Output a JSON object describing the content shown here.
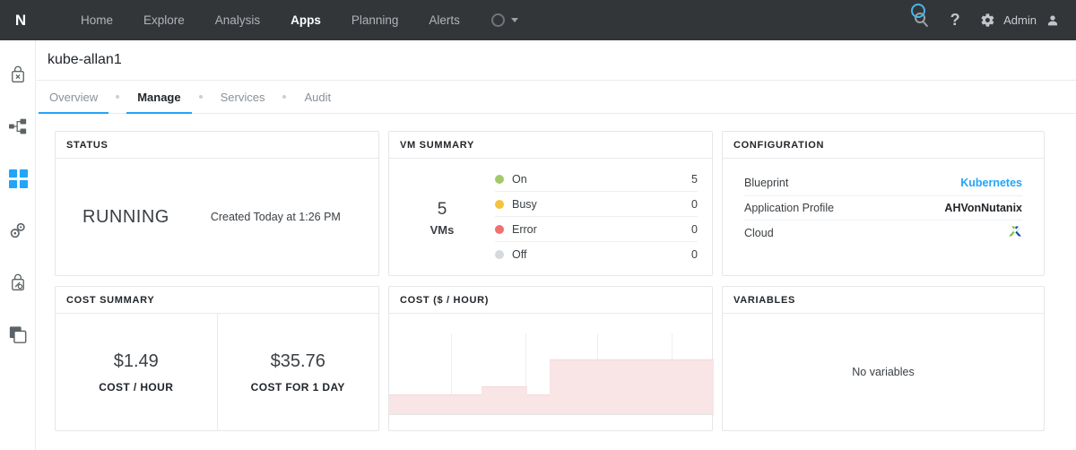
{
  "topnav": {
    "logo": "N",
    "items": [
      {
        "label": "Home",
        "active": false
      },
      {
        "label": "Explore",
        "active": false
      },
      {
        "label": "Analysis",
        "active": false
      },
      {
        "label": "Apps",
        "active": true
      },
      {
        "label": "Planning",
        "active": false
      },
      {
        "label": "Alerts",
        "active": false
      }
    ],
    "circle_menu_icon": "circle-chevron-icon",
    "search_icon": "search-icon",
    "help_icon": "question-mark-icon",
    "settings_icon": "gear-icon",
    "user_label": "Admin",
    "user_icon": "person-icon",
    "bg_color": "#333639",
    "cursor_highlight_color": "#48b5e8"
  },
  "rail": {
    "items": [
      {
        "icon": "bag-x-icon",
        "active": false
      },
      {
        "icon": "network-nodes-icon",
        "active": false
      },
      {
        "icon": "apps-grid-icon",
        "active": true
      },
      {
        "icon": "gears-icon",
        "active": false
      },
      {
        "icon": "bag-gear-icon",
        "active": false
      },
      {
        "icon": "layers-icon",
        "active": false
      }
    ],
    "active_color": "#22a5f7",
    "inactive_color": "#5c6366"
  },
  "page": {
    "title": "kube-allan1"
  },
  "tabs": [
    {
      "label": "Overview",
      "active": false,
      "underlined": true
    },
    {
      "label": "Manage",
      "active": true,
      "underlined": true
    },
    {
      "label": "Services",
      "active": false,
      "underlined": false
    },
    {
      "label": "Audit",
      "active": false,
      "underlined": false
    }
  ],
  "tabs_accent": "#22a5f7",
  "cards": {
    "status": {
      "title": "STATUS",
      "state": "RUNNING",
      "created": "Created Today at 1:26 PM"
    },
    "vm_summary": {
      "title": "VM SUMMARY",
      "total": "5",
      "total_label": "VMs",
      "rows": [
        {
          "label": "On",
          "value": "5",
          "color": "#a4c96a"
        },
        {
          "label": "Busy",
          "value": "0",
          "color": "#f3c33f"
        },
        {
          "label": "Error",
          "value": "0",
          "color": "#f2706f"
        },
        {
          "label": "Off",
          "value": "0",
          "color": "#d4d9dd"
        }
      ]
    },
    "configuration": {
      "title": "CONFIGURATION",
      "rows": [
        {
          "label": "Blueprint",
          "value": "Kubernetes",
          "style": "link"
        },
        {
          "label": "Application Profile",
          "value": "AHVonNutanix",
          "style": "bold"
        },
        {
          "label": "Cloud",
          "value": "",
          "style": "icon",
          "icon": "nutanix-x-icon"
        }
      ]
    },
    "cost_summary": {
      "title": "COST SUMMARY",
      "items": [
        {
          "amount": "$1.49",
          "label": "COST / HOUR"
        },
        {
          "amount": "$35.76",
          "label": "COST FOR 1 DAY"
        }
      ]
    },
    "cost_chart": {
      "title": "COST ($ / HOUR)"
    },
    "variables": {
      "title": "VARIABLES",
      "empty_text": "No variables"
    }
  },
  "chart_data": {
    "type": "area",
    "title": "COST ($ / HOUR)",
    "xlabel": "",
    "ylabel": "",
    "grid": true,
    "legend": null,
    "fill_color": "#f9e4e6",
    "line_color": "#f3d7da",
    "gridline_color": "#eceef0",
    "ylim": [
      0,
      2.2
    ],
    "x": [
      0,
      0.19,
      0.29,
      0.42,
      0.5,
      1.0
    ],
    "steps": [
      {
        "x_start": 0.0,
        "x_end": 0.285,
        "value": 0.55
      },
      {
        "x_start": 0.285,
        "x_end": 0.425,
        "value": 0.75
      },
      {
        "x_start": 0.425,
        "x_end": 0.495,
        "value": 0.55
      },
      {
        "x_start": 0.495,
        "x_end": 1.0,
        "value": 1.49
      }
    ],
    "gridlines_x": [
      0.19,
      0.42,
      0.64,
      0.87
    ]
  }
}
